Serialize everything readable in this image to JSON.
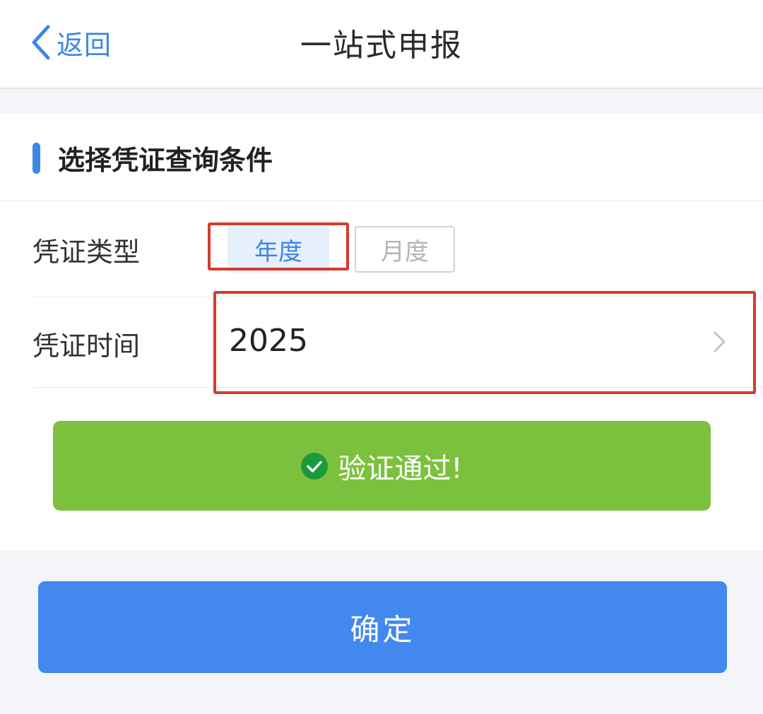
{
  "nav": {
    "back_label": "返回",
    "title": "一站式申报"
  },
  "section": {
    "title": "选择凭证查询条件"
  },
  "form": {
    "type_label": "凭证类型",
    "type_options": [
      "年度",
      "月度"
    ],
    "type_selected": "年度",
    "time_label": "凭证时间",
    "time_value": "2025"
  },
  "verify": {
    "message": "验证通过!"
  },
  "confirm_label": "确定",
  "colors": {
    "accent": "#3d86e8",
    "success": "#7cc13e",
    "primary_button": "#4288ef",
    "highlight": "#d63b30"
  },
  "icons": [
    "chevron-left-icon",
    "chevron-right-icon",
    "check-circle-icon"
  ]
}
